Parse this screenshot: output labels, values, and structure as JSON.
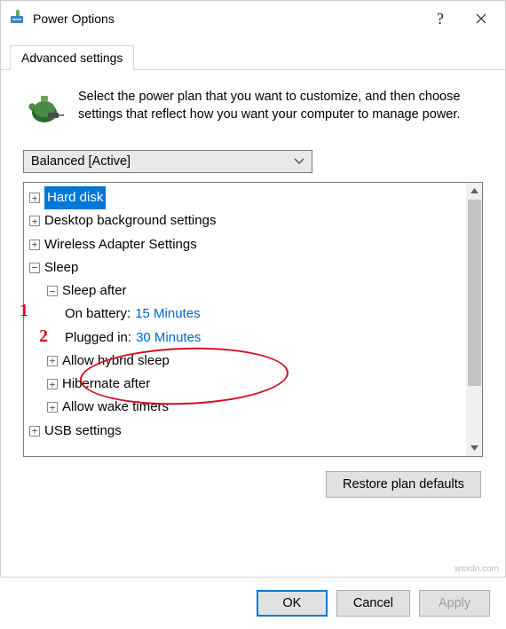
{
  "titlebar": {
    "title": "Power Options"
  },
  "tabs": {
    "advanced": "Advanced settings"
  },
  "description": "Select the power plan that you want to customize, and then choose settings that reflect how you want your computer to manage power.",
  "plan_selected": "Balanced [Active]",
  "tree": {
    "hard_disk": "Hard disk",
    "desktop_bg": "Desktop background settings",
    "wireless": "Wireless Adapter Settings",
    "sleep": "Sleep",
    "sleep_after": "Sleep after",
    "on_battery_label": "On battery: ",
    "on_battery_value": "15 Minutes",
    "plugged_in_label": "Plugged in: ",
    "plugged_in_value": "30 Minutes",
    "allow_hybrid": "Allow hybrid sleep",
    "hibernate_after": "Hibernate after",
    "allow_wake": "Allow wake timers",
    "usb": "USB settings"
  },
  "buttons": {
    "restore": "Restore plan defaults",
    "ok": "OK",
    "cancel": "Cancel",
    "apply": "Apply"
  },
  "annotations": {
    "a1": "1",
    "a2": "2"
  },
  "watermark": "wsxdn.com"
}
